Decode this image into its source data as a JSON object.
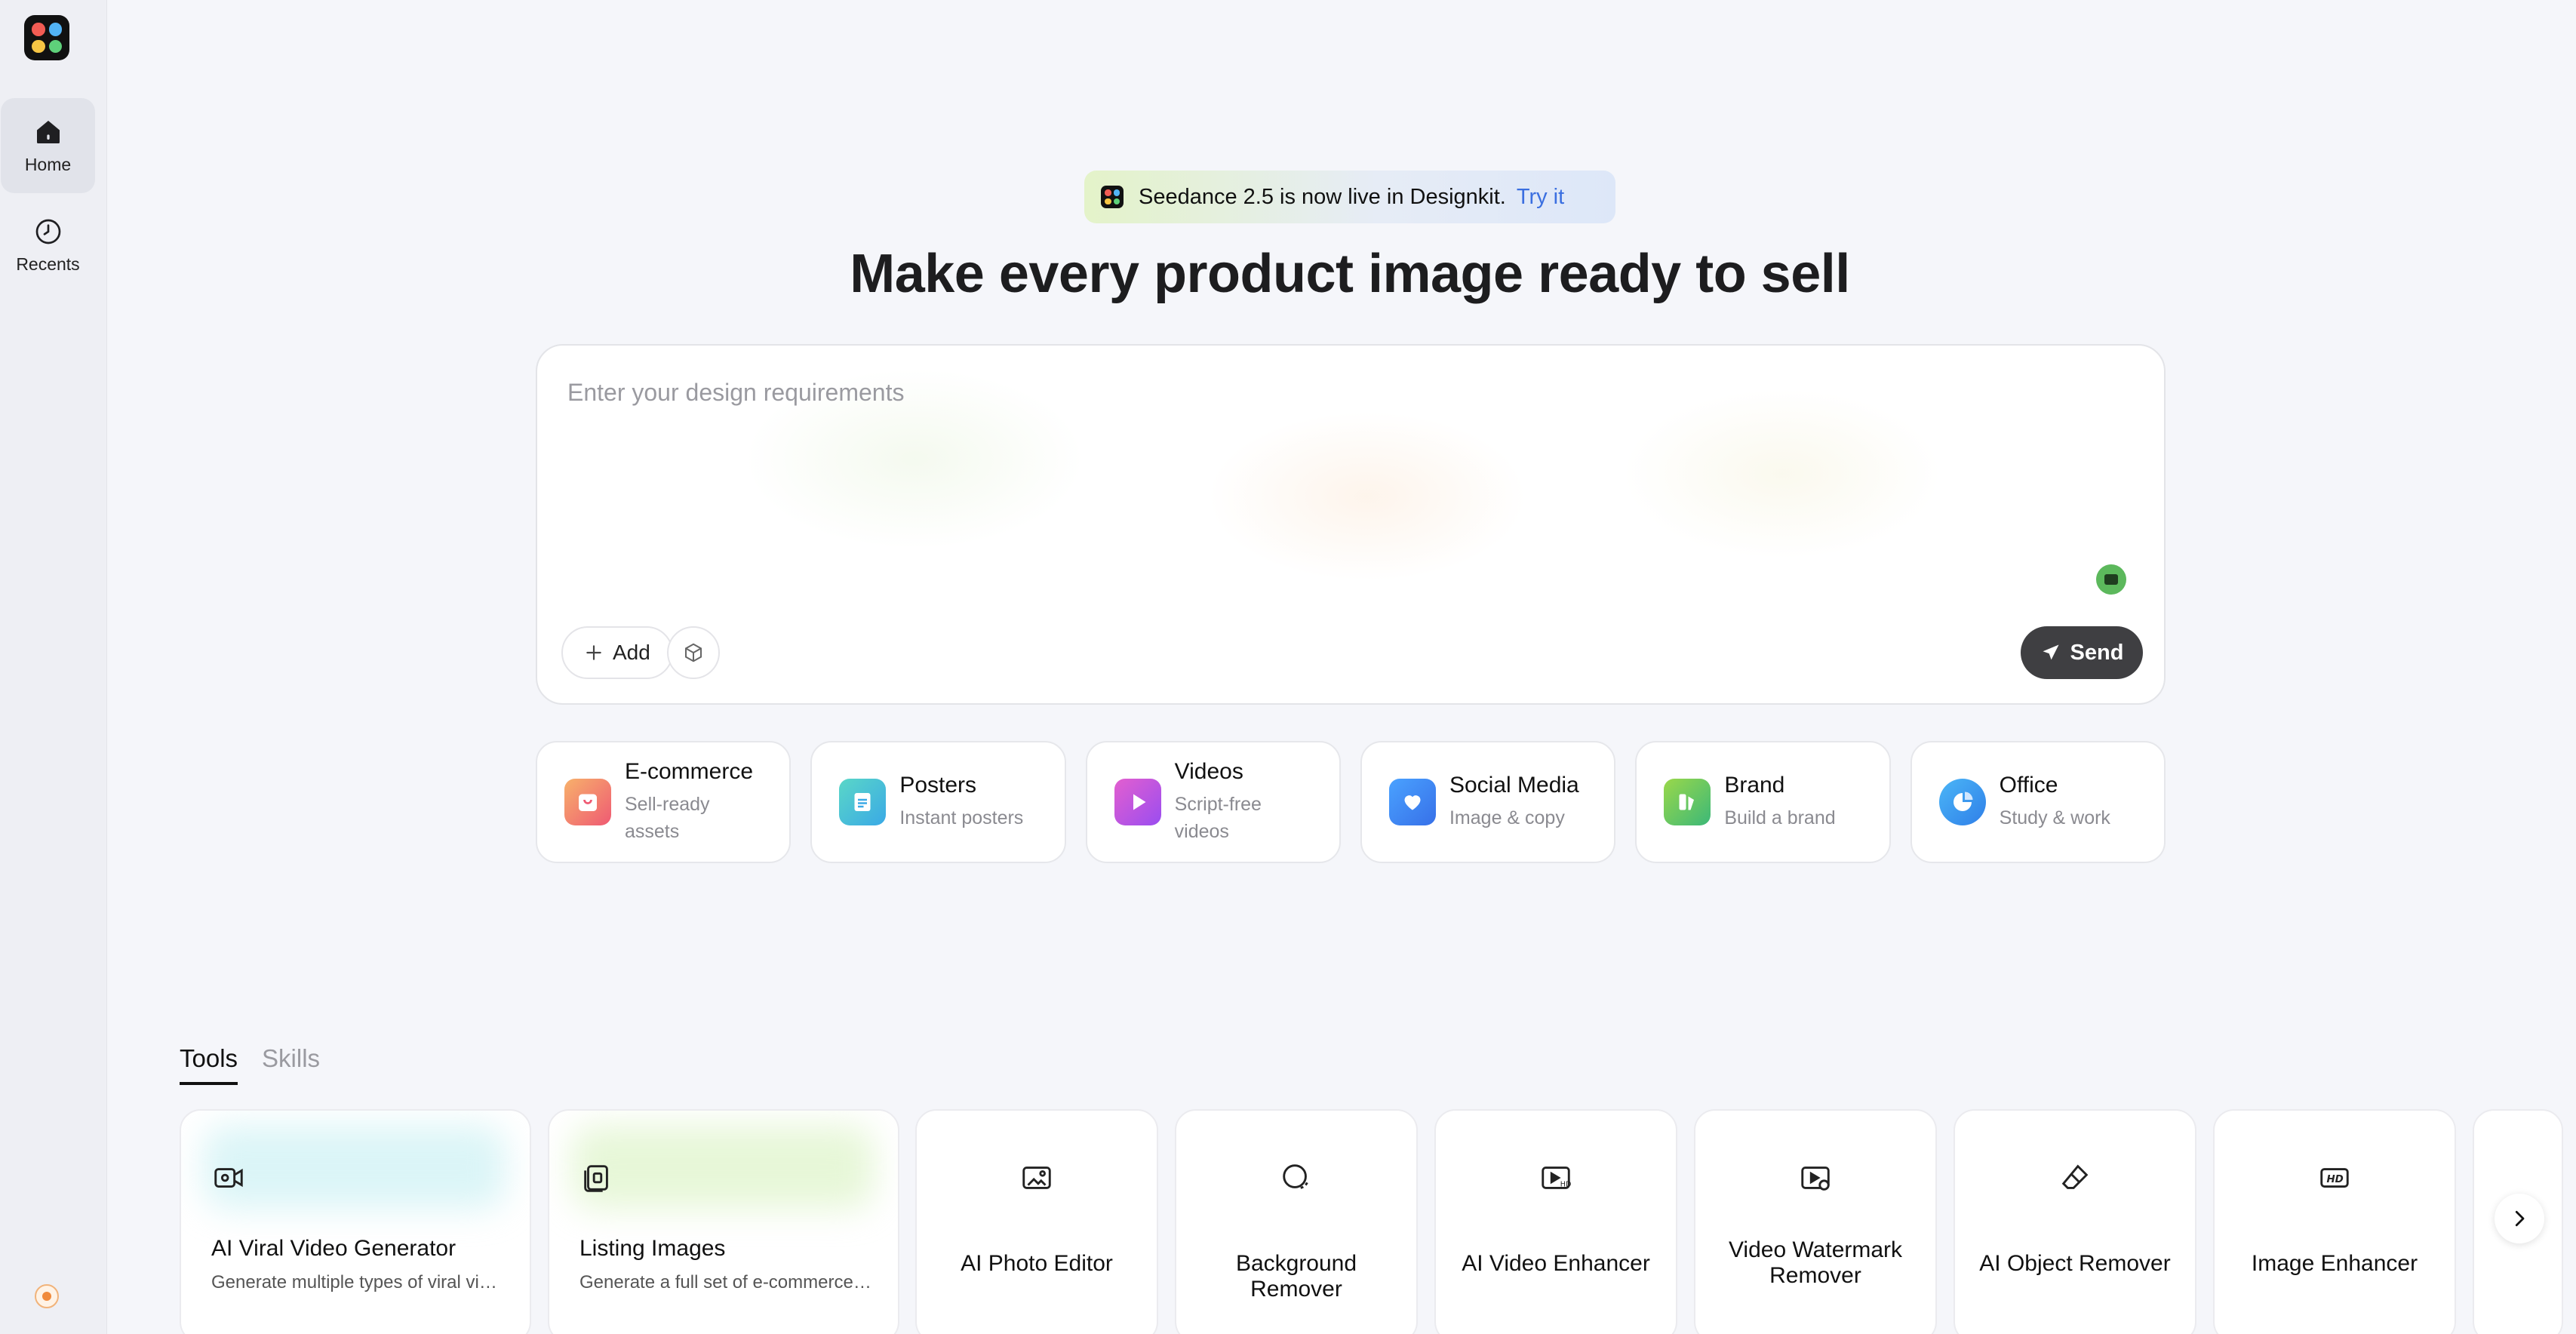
{
  "brand_colors": {
    "logo_red": "#f25c54",
    "logo_blue": "#52b3f5",
    "logo_yellow": "#f6c544",
    "logo_green": "#5ed17a"
  },
  "sidebar": {
    "items": [
      {
        "label": "Home",
        "icon": "home-icon",
        "active": true
      },
      {
        "label": "Recents",
        "icon": "clock-icon",
        "active": false
      }
    ]
  },
  "banner": {
    "text": "Seedance 2.5 is now live in Designkit.",
    "link": "Try it"
  },
  "headline": "Make every product image ready to sell",
  "prompt": {
    "placeholder": "Enter your design requirements",
    "value": "",
    "add_label": "Add",
    "send_label": "Send"
  },
  "categories": [
    {
      "title": "E-commerce",
      "subtitle": "Sell-ready assets",
      "icon": "shopping-bag-icon",
      "color": "#f0706a"
    },
    {
      "title": "Posters",
      "subtitle": "Instant posters",
      "icon": "poster-icon",
      "color": "#4fc4d9"
    },
    {
      "title": "Videos",
      "subtitle": "Script-free videos",
      "icon": "play-icon",
      "color": "#c04ee6"
    },
    {
      "title": "Social Media",
      "subtitle": "Image & copy",
      "icon": "heart-chat-icon",
      "color": "#3b8cf5"
    },
    {
      "title": "Brand",
      "subtitle": "Build a brand",
      "icon": "brand-icon",
      "color": "#56c55a"
    },
    {
      "title": "Office",
      "subtitle": "Study & work",
      "icon": "pie-chart-icon",
      "color": "#3d9af0"
    }
  ],
  "tabs": [
    {
      "label": "Tools",
      "active": true
    },
    {
      "label": "Skills",
      "active": false
    }
  ],
  "tools": [
    {
      "title": "AI Viral Video Generator",
      "desc": "Generate multiple types of viral videos",
      "icon": "video-camera-icon"
    },
    {
      "title": "Listing Images",
      "desc": "Generate a full set of e-commerce images",
      "icon": "listing-images-icon"
    },
    {
      "title": "AI Photo Editor",
      "icon": "image-edit-icon"
    },
    {
      "title": "Background Remover",
      "icon": "background-remove-icon"
    },
    {
      "title": "AI Video Enhancer",
      "icon": "video-hd-icon"
    },
    {
      "title": "Video Watermark Remover",
      "icon": "video-watermark-icon"
    },
    {
      "title": "AI Object Remover",
      "icon": "eraser-icon"
    },
    {
      "title": "Image Enhancer",
      "icon": "hd-icon"
    }
  ]
}
